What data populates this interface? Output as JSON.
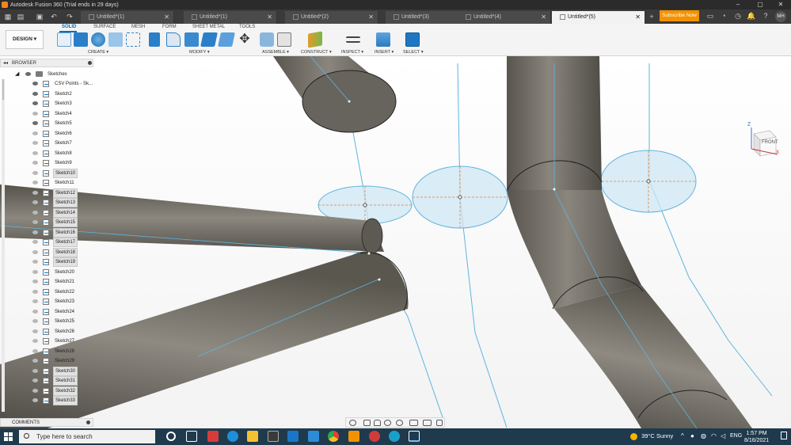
{
  "window": {
    "title": "Autodesk Fusion 360 (Trial ends in 29 days)",
    "controls": [
      "–",
      "▢",
      "✕"
    ]
  },
  "tabs": [
    {
      "label": "Untitled*(1)",
      "active": false
    },
    {
      "label": "Untitled*(1)",
      "active": false
    },
    {
      "label": "Untitled*(2)",
      "active": false
    },
    {
      "label": "Untitled*(3)",
      "active": false
    },
    {
      "label": "Untitled*(4)",
      "active": false
    },
    {
      "label": "Untitled*(5)",
      "active": true
    }
  ],
  "tab_close": "✕",
  "new_tab": "+",
  "subscribe": "Subscribe Now",
  "user_initials": "MH",
  "ribbon": {
    "workspace": "DESIGN ▾",
    "tabs": [
      "SOLID",
      "SURFACE",
      "MESH",
      "FORM",
      "SHEET METAL",
      "TOOLS"
    ],
    "groups": [
      "CREATE ▾",
      "MODIFY ▾",
      "ASSEMBLE ▾",
      "CONSTRUCT ▾",
      "INSPECT ▾",
      "INSERT ▾",
      "SELECT ▾"
    ]
  },
  "browser": {
    "title": "BROWSER",
    "collapse": "◂◂",
    "folder": "Sketches",
    "items": [
      {
        "label": "CSV Points - Sk...",
        "visible": true,
        "selected": false
      },
      {
        "label": "Sketch2",
        "visible": true,
        "selected": false
      },
      {
        "label": "Sketch3",
        "visible": true,
        "selected": false
      },
      {
        "label": "Sketch4",
        "visible": false,
        "selected": false
      },
      {
        "label": "Sketch5",
        "visible": true,
        "selected": false
      },
      {
        "label": "Sketch6",
        "visible": false,
        "selected": false
      },
      {
        "label": "Sketch7",
        "visible": false,
        "selected": false
      },
      {
        "label": "Sketch8",
        "visible": false,
        "selected": false
      },
      {
        "label": "Sketch9",
        "visible": false,
        "selected": false
      },
      {
        "label": "Sketch10",
        "visible": false,
        "selected": true
      },
      {
        "label": "Sketch11",
        "visible": false,
        "selected": false
      },
      {
        "label": "Sketch12",
        "visible": false,
        "selected": true
      },
      {
        "label": "Sketch13",
        "visible": false,
        "selected": true
      },
      {
        "label": "Sketch14",
        "visible": false,
        "selected": true
      },
      {
        "label": "Sketch15",
        "visible": false,
        "selected": true
      },
      {
        "label": "Sketch16",
        "visible": false,
        "selected": true
      },
      {
        "label": "Sketch17",
        "visible": false,
        "selected": true
      },
      {
        "label": "Sketch18",
        "visible": false,
        "selected": true
      },
      {
        "label": "Sketch19",
        "visible": false,
        "selected": true
      },
      {
        "label": "Sketch20",
        "visible": false,
        "selected": false
      },
      {
        "label": "Sketch21",
        "visible": false,
        "selected": false
      },
      {
        "label": "Sketch22",
        "visible": false,
        "selected": false
      },
      {
        "label": "Sketch23",
        "visible": false,
        "selected": false
      },
      {
        "label": "Sketch24",
        "visible": false,
        "selected": false
      },
      {
        "label": "Sketch25",
        "visible": false,
        "selected": false
      },
      {
        "label": "Sketch26",
        "visible": false,
        "selected": false
      },
      {
        "label": "Sketch27",
        "visible": false,
        "selected": false
      },
      {
        "label": "Sketch28",
        "visible": false,
        "selected": false
      },
      {
        "label": "Sketch29",
        "visible": false,
        "selected": false
      },
      {
        "label": "Sketch30",
        "visible": false,
        "selected": true
      },
      {
        "label": "Sketch31",
        "visible": false,
        "selected": true
      },
      {
        "label": "Sketch32",
        "visible": false,
        "selected": true
      },
      {
        "label": "Sketch33",
        "visible": false,
        "selected": true
      }
    ]
  },
  "comments": {
    "title": "COMMENTS"
  },
  "viewcube": {
    "face": "FRONT",
    "axis_z": "Z",
    "axis_x": "X"
  },
  "taskbar": {
    "search_placeholder": "Type here to search",
    "weather_temp": "39°C",
    "weather_desc": "Sunny",
    "lang": "ENG",
    "time": "1:57 PM",
    "date": "8/16/2021"
  },
  "colors": {
    "tube": "#6e6b64",
    "sketch_line": "#5fb4de",
    "profile_fill": "#cfe7f4",
    "accent": "#0a6fb8",
    "subscribe": "#f39200"
  }
}
